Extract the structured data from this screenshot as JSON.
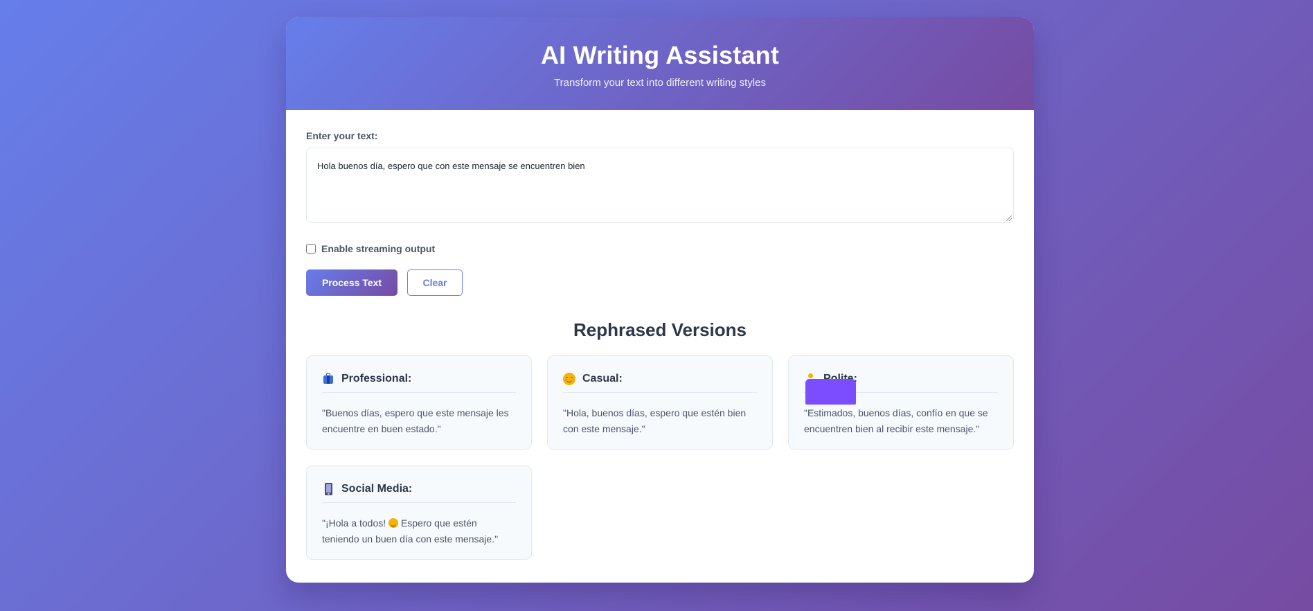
{
  "header": {
    "title": "AI Writing Assistant",
    "subtitle": "Transform your text into different writing styles"
  },
  "input": {
    "label": "Enter your text:",
    "value": "Hola buenos día, espero que con este mensaje se encuentren bien"
  },
  "options": {
    "streaming_label": "Enable streaming output",
    "streaming_checked": false
  },
  "actions": {
    "process_label": "Process Text",
    "clear_label": "Clear"
  },
  "results": {
    "title": "Rephrased Versions",
    "items": [
      {
        "icon": "briefcase-icon",
        "label": "Professional:",
        "text_line1": "\"Buenos días, espero que este mensaje les",
        "text_line2": "encuentre en buen estado.\""
      },
      {
        "icon": "smiling-face-icon",
        "label": "Casual:",
        "text_line1": "\"Hola, buenos días, espero que estén bien",
        "text_line2": "con este mensaje.\""
      },
      {
        "icon": "bowing-person-icon",
        "label": "Polite:",
        "text_line1": "\"Estimados, buenos días, confío en que se",
        "text_line2": "encuentren bien al recibir este mensaje.\""
      },
      {
        "icon": "mobile-phone-icon",
        "label": "Social Media:",
        "text_line1a": "\"¡Hola a todos! ",
        "text_line1b": " Espero que estén",
        "text_line2": "teniendo un buen día con este mensaje.\""
      }
    ]
  },
  "colors": {
    "gradient_start": "#667eea",
    "gradient_end": "#764ba2",
    "heading_text": "#2d3748",
    "body_text": "#4a5568"
  }
}
